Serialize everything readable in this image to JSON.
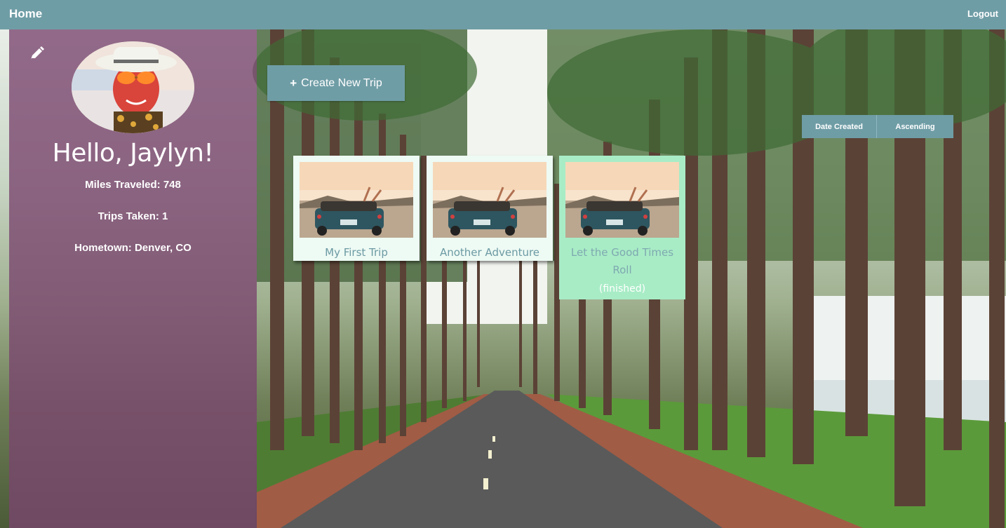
{
  "nav": {
    "home_label": "Home",
    "logout_label": "Logout"
  },
  "profile": {
    "greeting": "Hello, Jaylyn!",
    "miles": "Miles Traveled: 748",
    "trips": "Trips Taken: 1",
    "hometown": "Hometown: Denver, CO",
    "edit_icon": "pencil-icon"
  },
  "actions": {
    "create_label": "Create New Trip",
    "create_icon": "plus-icon"
  },
  "sort": {
    "field_label": "Date Created",
    "order_label": "Ascending"
  },
  "trips": [
    {
      "title": "My First Trip",
      "status": ""
    },
    {
      "title": "Another Adventure",
      "status": ""
    },
    {
      "title": "Let the Good Times Roll",
      "status": "(finished)"
    }
  ],
  "colors": {
    "nav": "#6f9da6",
    "sidebar": "#7a446e",
    "card": "#eefaf4",
    "card_finished": "#a8ecc6"
  }
}
